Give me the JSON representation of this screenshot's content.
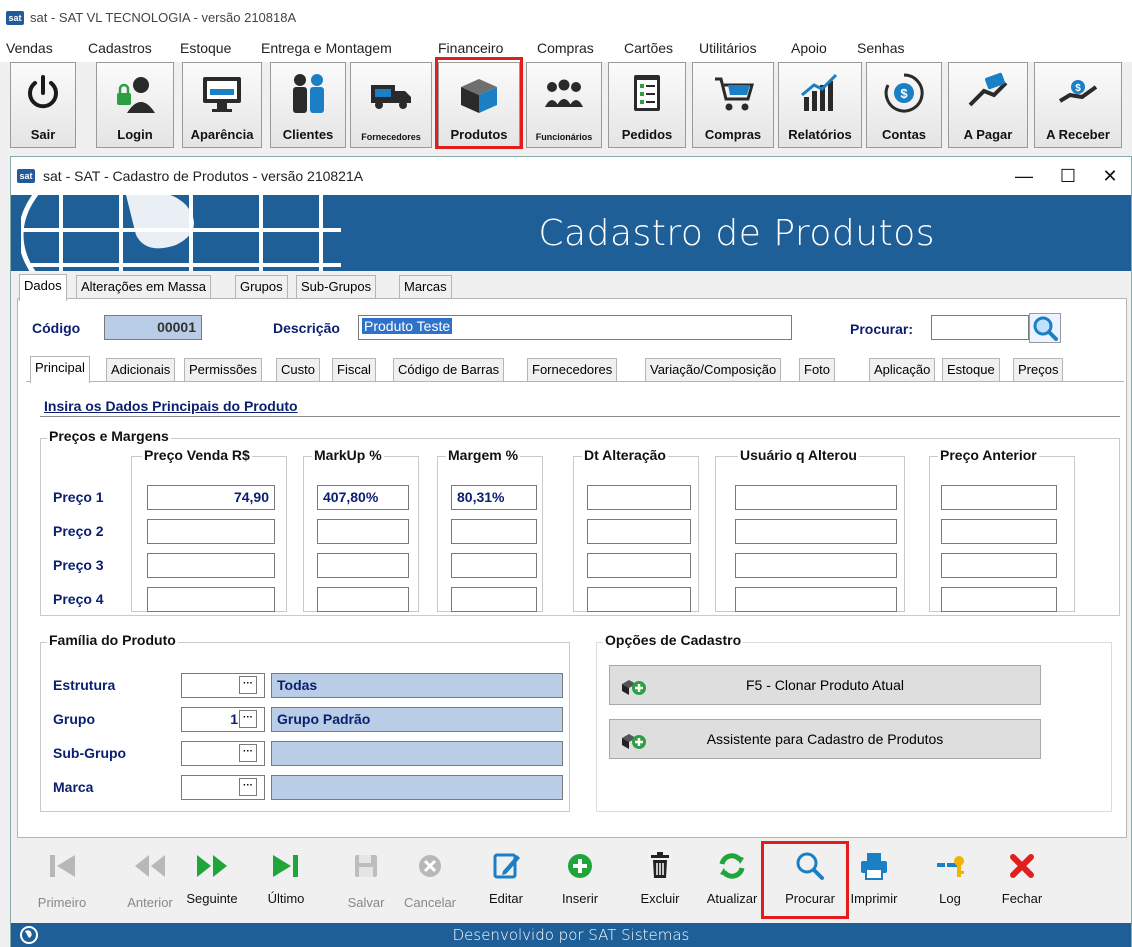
{
  "app": {
    "title": "sat - SAT VL TECNOLOGIA  - versão 210818A",
    "icon": "sat"
  },
  "menu": [
    "Vendas",
    "Cadastros",
    "Estoque",
    "Entrega e Montagem",
    "Financeiro",
    "Compras",
    "Cartões",
    "Utilitários",
    "Apoio",
    "Senhas"
  ],
  "toolbar": [
    {
      "label": "Sair",
      "icon": "power-icon"
    },
    {
      "label": "Login",
      "icon": "user-lock-icon"
    },
    {
      "label": "Aparência",
      "icon": "monitor-icon"
    },
    {
      "label": "Clientes",
      "icon": "people-icon"
    },
    {
      "label": "Fornecedores",
      "icon": "truck-icon"
    },
    {
      "label": "Produtos",
      "icon": "box-icon"
    },
    {
      "label": "Funcionários",
      "icon": "group-icon"
    },
    {
      "label": "Pedidos",
      "icon": "clipboard-icon"
    },
    {
      "label": "Compras",
      "icon": "cart-icon"
    },
    {
      "label": "Relatórios",
      "icon": "chart-icon"
    },
    {
      "label": "Contas",
      "icon": "coins-icon"
    },
    {
      "label": "A Pagar",
      "icon": "pay-icon"
    },
    {
      "label": "A Receber",
      "icon": "receive-icon"
    }
  ],
  "window": {
    "title": "sat - SAT - Cadastro de Produtos - versão 210821A",
    "icon": "sat",
    "banner": "Cadastro de Produtos",
    "controls": {
      "minimize": "—",
      "maximize": "☐",
      "close": "✕"
    }
  },
  "tabs_top": [
    "Dados",
    "Alterações em Massa",
    "Grupos",
    "Sub-Grupos",
    "Marcas"
  ],
  "header": {
    "codigo_label": "Código",
    "codigo_value": "00001",
    "descricao_label": "Descrição",
    "descricao_value": "Produto Teste",
    "procurar_label": "Procurar:",
    "procurar_value": ""
  },
  "tabs_inner": [
    "Principal",
    "Adicionais",
    "Permissões",
    "Custo",
    "Fiscal",
    "Código de Barras",
    "Fornecedores",
    "Variação/Composição",
    "Foto",
    "Aplicação",
    "Estoque",
    "Preços"
  ],
  "section_title": "Insira os Dados Principais do Produto",
  "precos": {
    "group_title": "Preços e Margens",
    "columns": {
      "preco_venda": "Preço Venda R$",
      "markup": "MarkUp %",
      "margem": "Margem %",
      "dt_alteracao": "Dt Alteração",
      "usuario": "Usuário q Alterou",
      "preco_anterior": "Preço Anterior"
    },
    "rows": [
      {
        "label": "Preço 1",
        "preco_venda": "74,90",
        "markup": "407,80%",
        "margem": "80,31%"
      },
      {
        "label": "Preço 2",
        "preco_venda": "",
        "markup": "",
        "margem": ""
      },
      {
        "label": "Preço 3",
        "preco_venda": "",
        "markup": "",
        "margem": ""
      },
      {
        "label": "Preço 4",
        "preco_venda": "",
        "markup": "",
        "margem": ""
      }
    ]
  },
  "familia": {
    "group_title": "Família do Produto",
    "rows": [
      {
        "label": "Estrutura",
        "code": "",
        "value": "Todas"
      },
      {
        "label": "Grupo",
        "code": "1",
        "value": "Grupo Padrão"
      },
      {
        "label": "Sub-Grupo",
        "code": "",
        "value": ""
      },
      {
        "label": "Marca",
        "code": "",
        "value": ""
      }
    ],
    "ellipsis": "···"
  },
  "opcoes": {
    "group_title": "Opções de Cadastro",
    "clonar": "F5 - Clonar Produto Atual",
    "assistente": "Assistente para Cadastro de Produtos"
  },
  "navbar": [
    {
      "label": "Primeiro",
      "icon": "first-icon",
      "enabled": false
    },
    {
      "label": "Anterior",
      "icon": "previous-icon",
      "enabled": false
    },
    {
      "label": "Seguinte",
      "icon": "next-icon",
      "enabled": true
    },
    {
      "label": "Último",
      "icon": "last-icon",
      "enabled": true
    },
    {
      "label": "Salvar",
      "icon": "save-icon",
      "enabled": false
    },
    {
      "label": "Cancelar",
      "icon": "cancel-icon",
      "enabled": false
    },
    {
      "label": "Editar",
      "icon": "edit-icon",
      "enabled": true
    },
    {
      "label": "Inserir",
      "icon": "insert-icon",
      "enabled": true
    },
    {
      "label": "Excluir",
      "icon": "delete-icon",
      "enabled": true
    },
    {
      "label": "Atualizar",
      "icon": "refresh-icon",
      "enabled": true
    },
    {
      "label": "Procurar",
      "icon": "search-icon",
      "enabled": true
    },
    {
      "label": "Imprimir",
      "icon": "print-icon",
      "enabled": true
    },
    {
      "label": "Log",
      "icon": "key-icon",
      "enabled": true
    },
    {
      "label": "Fechar",
      "icon": "close-icon",
      "enabled": true
    }
  ],
  "footer": "Desenvolvido por SAT Sistemas",
  "colors": {
    "banner": "#1e5f98",
    "label_blue": "#0a1f6e",
    "highlight": "#e51c1c",
    "field_blue": "#b9cde6"
  }
}
